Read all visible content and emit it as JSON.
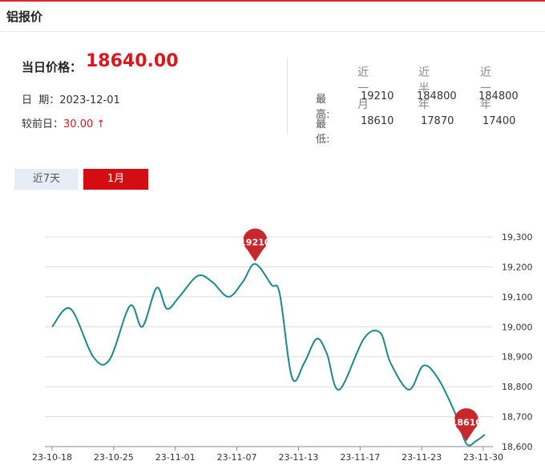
{
  "header": {
    "title": "铝报价"
  },
  "summary": {
    "price_label": "当日价格：",
    "price_value": "18640.00",
    "date_label": "日  期：",
    "date_value": "2023-12-01",
    "change_label": "较前日：",
    "change_value": "30.00 ↑"
  },
  "stats": {
    "columns": [
      "近一月",
      "近半年",
      "近一年"
    ],
    "rows": [
      {
        "label": "最高:",
        "values": [
          "19210",
          "184800",
          "184800"
        ]
      },
      {
        "label": "最低:",
        "values": [
          "18610",
          "17870",
          "17400"
        ]
      }
    ]
  },
  "tabs": [
    {
      "label": "近7天",
      "active": false
    },
    {
      "label": "1月",
      "active": true
    }
  ],
  "colors": {
    "accent": "#d40d12",
    "line": "#1a8a8a",
    "price": "#e0151b",
    "pin": "#c8282b"
  },
  "chart_data": {
    "type": "line",
    "x_ticks": [
      "23-10-18",
      "23-10-25",
      "23-11-01",
      "23-11-07",
      "23-11-13",
      "23-11-17",
      "23-11-23",
      "23-11-30"
    ],
    "y_ticks": [
      "18,600",
      "18,700",
      "18,800",
      "18,900",
      "19,000",
      "19,100",
      "19,200",
      "19,300"
    ],
    "ylim": [
      18600,
      19300
    ],
    "xlim": [
      0,
      21.3
    ],
    "grid": true,
    "series": [
      {
        "x": [
          0,
          0.9,
          2,
          2.8,
          3.8,
          4.4,
          5.1,
          5.6,
          6.2,
          7.1,
          7.8,
          8.6,
          9.3,
          9.9,
          10.7,
          11.1,
          11.7,
          12.3,
          12.9,
          13.4,
          14,
          15.2,
          16,
          16.5,
          17.4,
          18.1,
          18.8,
          19.6,
          20.2,
          20.7,
          21.1
        ],
        "values": [
          19000,
          19060,
          18900,
          18890,
          19070,
          19000,
          19130,
          19060,
          19100,
          19170,
          19150,
          19100,
          19150,
          19210,
          19140,
          19110,
          18830,
          18880,
          18960,
          18910,
          18790,
          18960,
          18980,
          18880,
          18790,
          18870,
          18830,
          18720,
          18610,
          18620,
          18640
        ]
      }
    ],
    "markers": [
      {
        "label": "19210",
        "x": 9.9,
        "value": 19210
      },
      {
        "label": "18610",
        "x": 20.2,
        "value": 18610
      }
    ]
  }
}
